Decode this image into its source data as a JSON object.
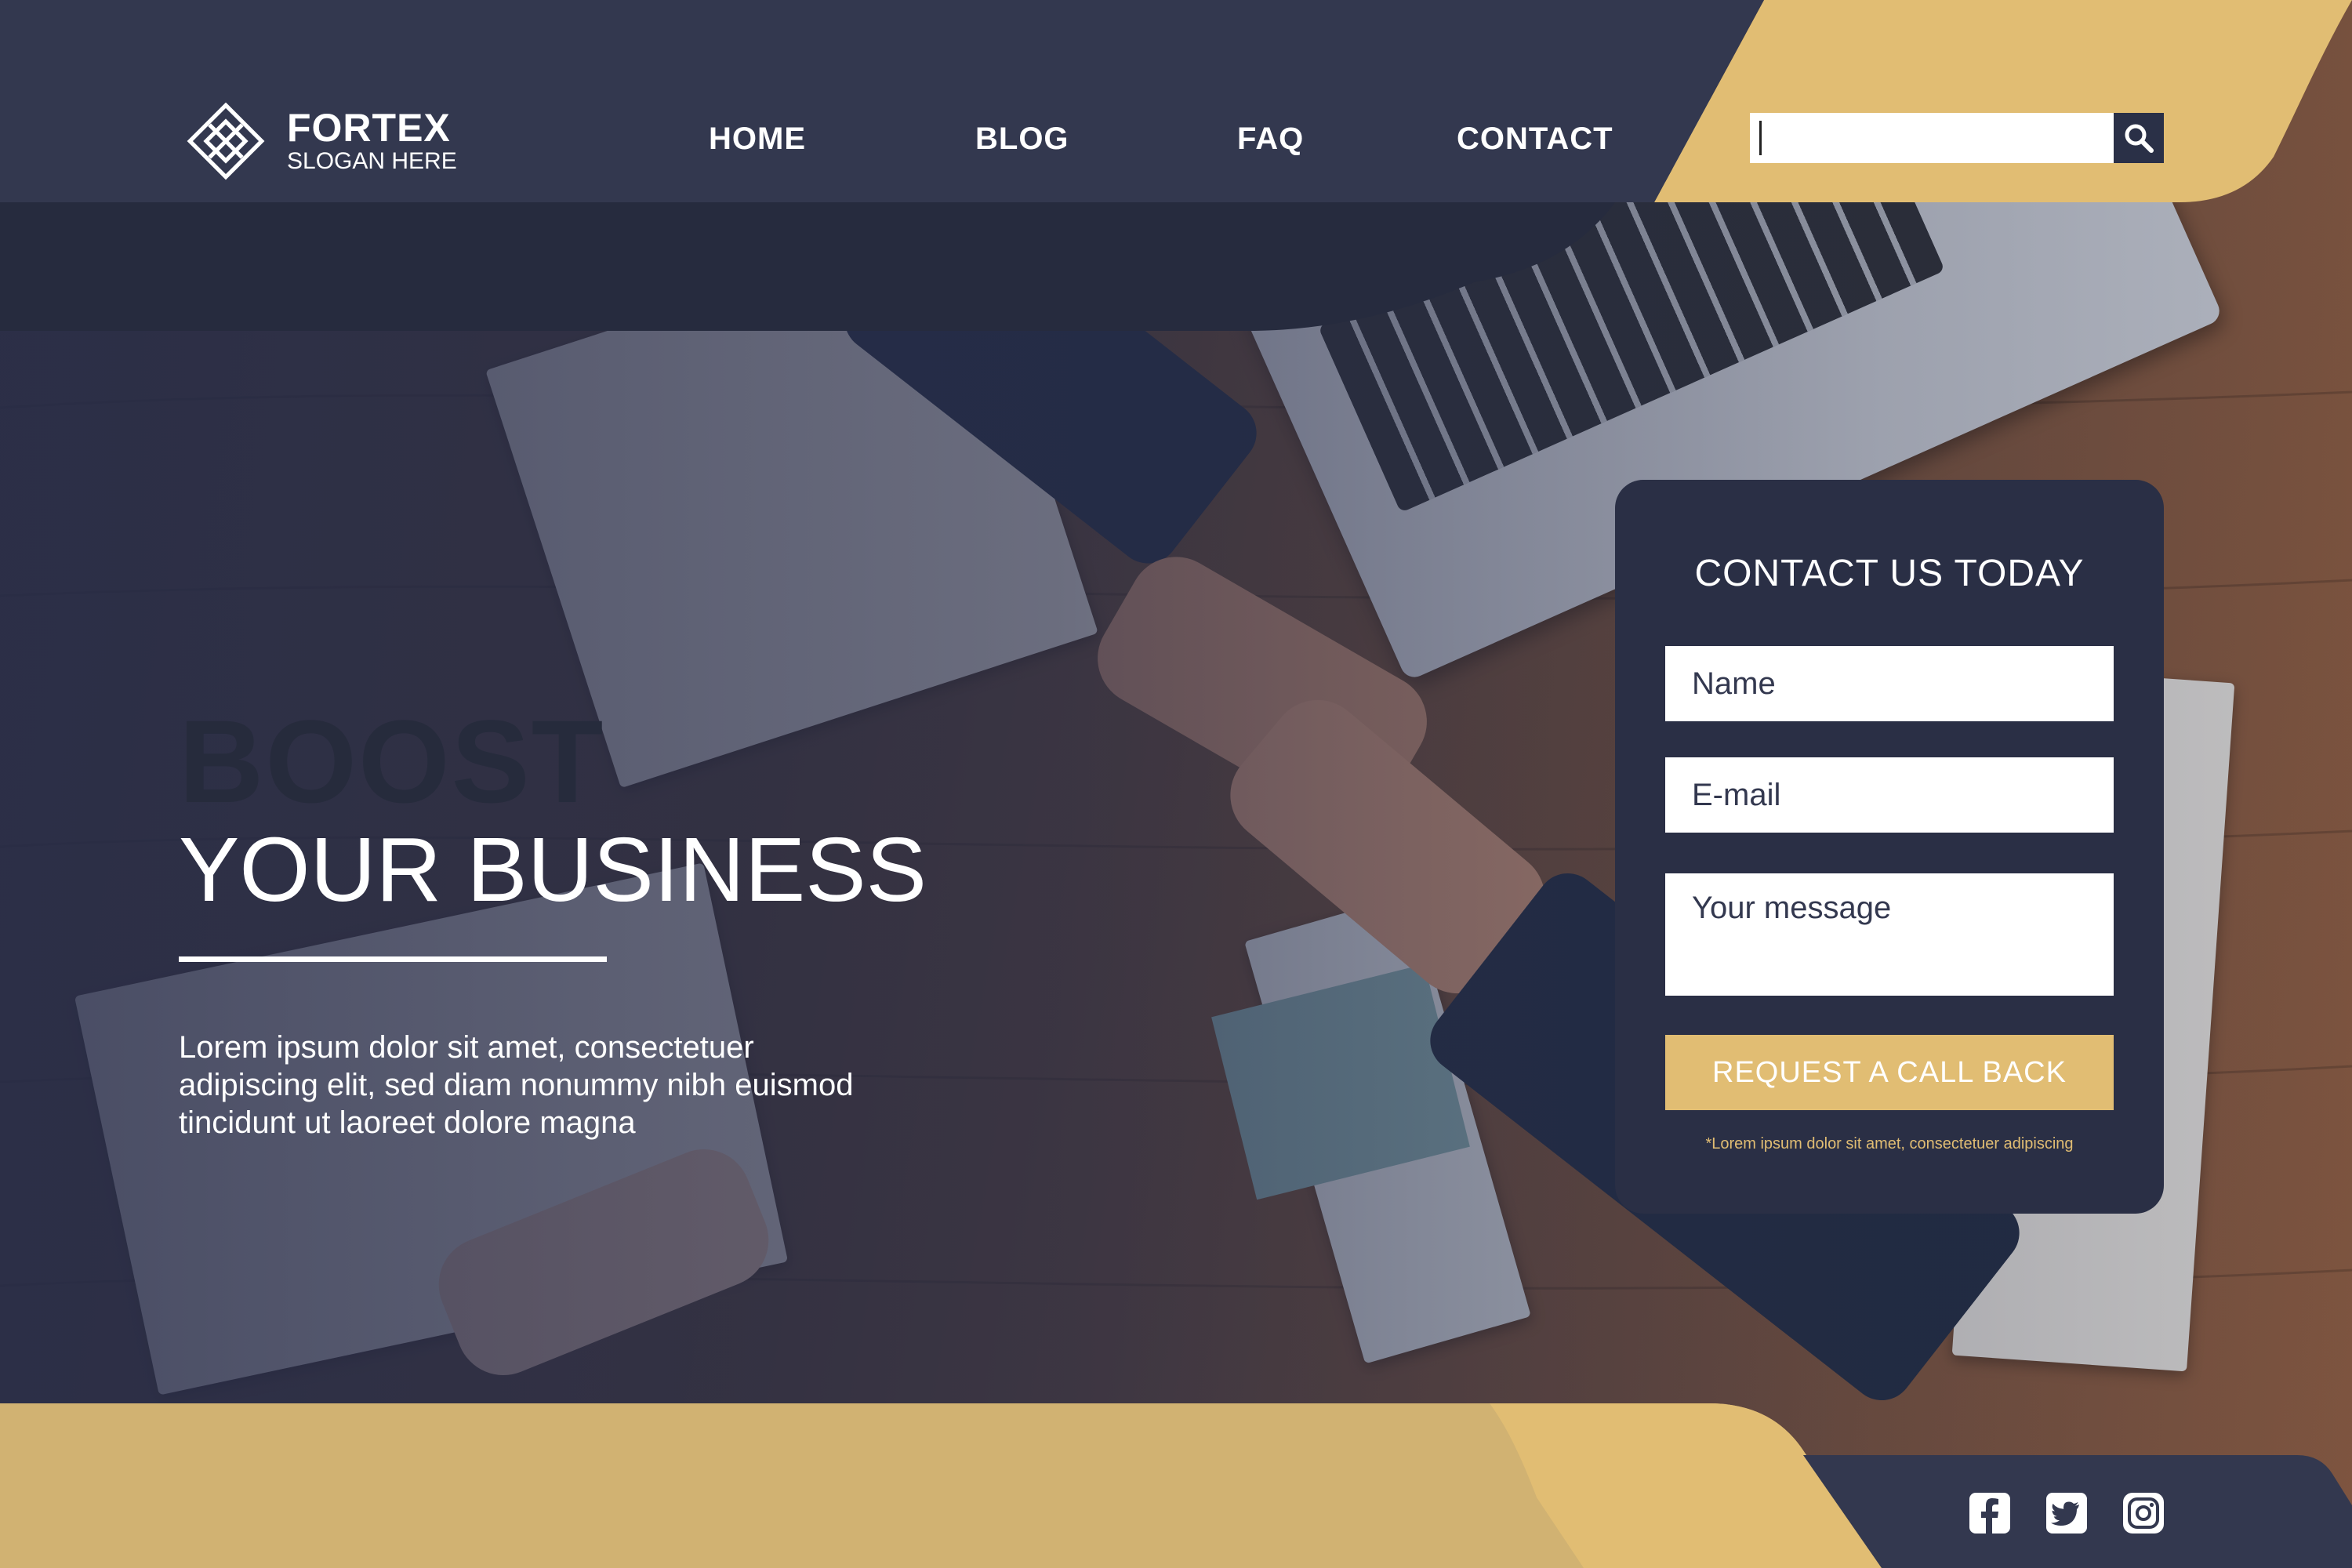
{
  "brand": {
    "name": "FORTEX",
    "slogan": "SLOGAN HERE",
    "logo_icon": "diamond-lattice-icon"
  },
  "nav": {
    "items": [
      {
        "label": "HOME"
      },
      {
        "label": "BLOG"
      },
      {
        "label": "FAQ"
      },
      {
        "label": "CONTACT"
      }
    ]
  },
  "search": {
    "value": "",
    "icon": "search-icon"
  },
  "hero": {
    "headline_strong": "BOOST",
    "headline": "YOUR BUSINESS",
    "description": "Lorem ipsum dolor sit amet, consectetuer adipiscing elit, sed diam nonummy nibh euismod tincidunt ut laoreet dolore magna"
  },
  "contact_form": {
    "title": "CONTACT US TODAY",
    "name_placeholder": "Name",
    "email_placeholder": "E-mail",
    "message_placeholder": "Your message",
    "submit_label": "REQUEST A CALL BACK",
    "note": "*Lorem ipsum dolor sit amet, consectetuer adipiscing"
  },
  "social": [
    {
      "icon": "facebook-icon"
    },
    {
      "icon": "twitter-icon"
    },
    {
      "icon": "instagram-icon"
    }
  ],
  "colors": {
    "navy": "#33384f",
    "navy_dark": "#2a2f45",
    "gold": "#e1bd73",
    "gold_dark": "#d1b272",
    "white": "#ffffff"
  }
}
